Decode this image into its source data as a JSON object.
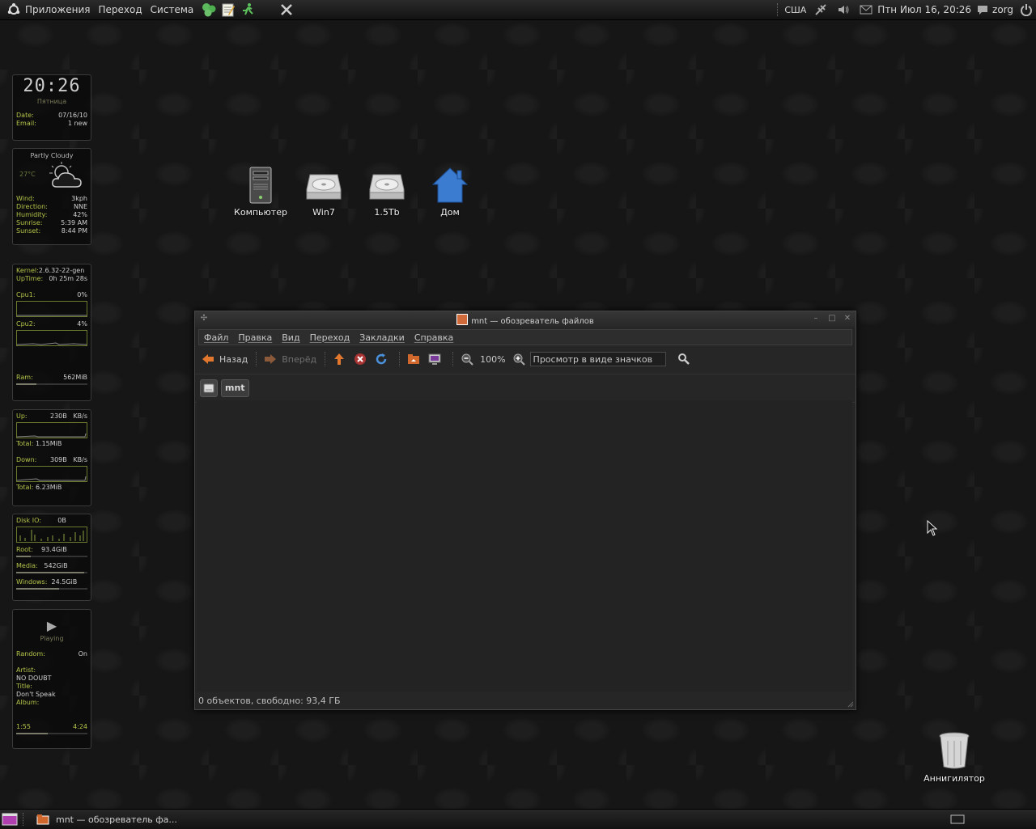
{
  "top_panel": {
    "menus": [
      "Приложения",
      "Переход",
      "Система"
    ],
    "layout": "США",
    "datetime": "Птн Июл 16, 20:26",
    "user": "zorg"
  },
  "widgets": {
    "clock": {
      "time": "20:26",
      "day": "Пятница",
      "date_label": "Date:",
      "date": "07/16/10",
      "email_label": "Email:",
      "email": "1 new"
    },
    "weather": {
      "condition": "Partly Cloudy",
      "temp": "27°C",
      "rows": [
        {
          "label": "Wind:",
          "value": "3kph"
        },
        {
          "label": "Direction:",
          "value": "NNE"
        },
        {
          "label": "Humidity:",
          "value": "42%"
        },
        {
          "label": "Sunrise:",
          "value": "5:39 AM"
        },
        {
          "label": "Sunset:",
          "value": "8:44 PM"
        }
      ]
    },
    "system": {
      "kernel_label": "Kernel:",
      "kernel": "2.6.32-22-gen",
      "uptime_label": "UpTime:",
      "uptime": "0h 25m 28s",
      "cpu1_label": "Cpu1:",
      "cpu1": "0%",
      "cpu2_label": "Cpu2:",
      "cpu2": "4%",
      "ram_label": "Ram:",
      "ram": "562MiB",
      "ram_fraction": 0.28
    },
    "network": {
      "up_label": "Up:",
      "up": "230B",
      "up_unit": "KB/s",
      "up_total_label": "Total:",
      "up_total": "1.15MiB",
      "down_label": "Down:",
      "down": "309B",
      "down_unit": "KB/s",
      "down_total_label": "Total:",
      "down_total": "6.23MiB"
    },
    "disk": {
      "io_label": "Disk IO:",
      "io": "0B",
      "root_label": "Root:",
      "root": "93.4GiB",
      "root_fraction": 0.2,
      "media_label": "Media:",
      "media": "542GiB",
      "media_fraction": 0.95,
      "windows_label": "Windows:",
      "windows": "24.5GiB",
      "windows_fraction": 0.6
    },
    "player": {
      "status": "Playing",
      "random_label": "Random:",
      "random": "On",
      "artist_label": "Artist:",
      "artist": "NO DOUBT",
      "title_label": "Title:",
      "title": "Don't Speak",
      "album_label": "Album:",
      "album": "",
      "elapsed": "1:55",
      "total": "4:24",
      "progress": 0.44
    }
  },
  "desktop_icons": [
    {
      "label": "Компьютер",
      "icon": "computer-icon"
    },
    {
      "label": "Win7",
      "icon": "harddisk-icon"
    },
    {
      "label": "1.5Tb",
      "icon": "harddisk-icon"
    },
    {
      "label": "Дом",
      "icon": "home-icon"
    }
  ],
  "trash": {
    "label": "Аннигилятор"
  },
  "window": {
    "title": "mnt — обозреватель файлов",
    "menu": [
      "Файл",
      "Правка",
      "Вид",
      "Переход",
      "Закладки",
      "Справка"
    ],
    "back": "Назад",
    "forward": "Вперёд",
    "zoom": "100%",
    "view_mode": "Просмотр в виде значков",
    "path": "mnt",
    "status": "0 объектов, свободно: 93,4 ГБ"
  },
  "taskbar": {
    "task": "mnt — обозреватель фа..."
  },
  "colors": {
    "accent": "#b5c44a",
    "background": "#161616"
  }
}
